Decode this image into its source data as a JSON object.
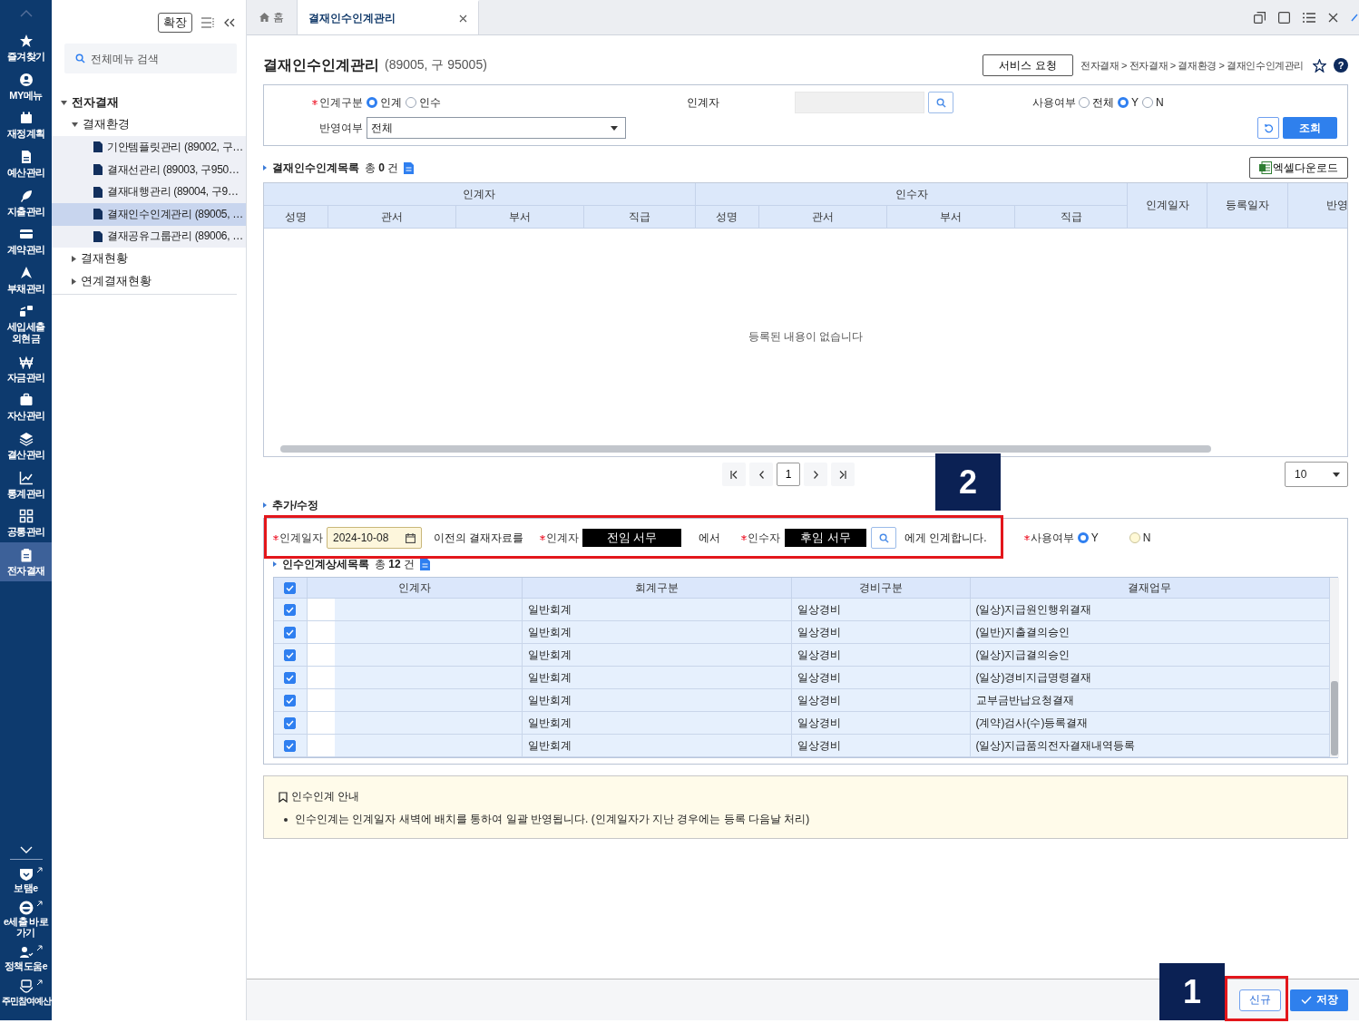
{
  "rail": {
    "items": [
      {
        "label": "즐겨찾기",
        "selected": false
      },
      {
        "label": "MY메뉴",
        "selected": false
      },
      {
        "label": "재정계획",
        "selected": false
      },
      {
        "label": "예산관리",
        "selected": false
      },
      {
        "label": "지출관리",
        "selected": false
      },
      {
        "label": "계약관리",
        "selected": false
      },
      {
        "label": "부채관리",
        "selected": false
      },
      {
        "label": "세입세출 외현금",
        "selected": false
      },
      {
        "label": "자금관리",
        "selected": false
      },
      {
        "label": "자산관리",
        "selected": false
      },
      {
        "label": "결산관리",
        "selected": false
      },
      {
        "label": "통계관리",
        "selected": false
      },
      {
        "label": "공통관리",
        "selected": false
      },
      {
        "label": "전자결재",
        "selected": true
      }
    ],
    "links": [
      {
        "label": "보탬e"
      },
      {
        "label": "e세출 바로가기"
      },
      {
        "label": "정책도움e"
      },
      {
        "label": "주민참여예산"
      }
    ]
  },
  "menu": {
    "expand_button": "확장",
    "search": {
      "placeholder": "전체메뉴 검색"
    },
    "tree": [
      {
        "label": "전자결재",
        "expanded": true,
        "children": [
          {
            "label": "결재환경",
            "expanded": true,
            "children": [
              {
                "label": "기안템플릿관리 (89002, 구…",
                "selected": false
              },
              {
                "label": "결재선관리 (89003, 구950…",
                "selected": false
              },
              {
                "label": "결재대행관리 (89004, 구9…",
                "selected": false
              },
              {
                "label": "결재인수인계관리 (89005, …",
                "selected": true
              },
              {
                "label": "결재공유그룹관리 (89006, …",
                "selected": false
              }
            ]
          },
          {
            "label": "결재현황",
            "expanded": false
          },
          {
            "label": "연계결재현황",
            "expanded": false
          }
        ]
      }
    ]
  },
  "tabs": [
    {
      "kind": "home",
      "label": "홈",
      "selected": false
    },
    {
      "kind": "page",
      "label": "결재인수인계관리",
      "selected": true
    }
  ],
  "page": {
    "title": "결재인수인계관리",
    "code": "(89005, 구 95005)",
    "service_button": "서비스 요청",
    "breadcrumb": "전자결재 > 전자결재 > 결재환경 > 결재인수인계관리",
    "help_button": "?"
  },
  "search_form": {
    "transfer_type": {
      "label": "인계구분",
      "required": true,
      "options": [
        {
          "label": "인계",
          "selected": true
        },
        {
          "label": "인수",
          "selected": false
        }
      ]
    },
    "giver": {
      "label": "인계자"
    },
    "use": {
      "label": "사용여부",
      "options": [
        {
          "label": "전체",
          "selected": false
        },
        {
          "label": "Y",
          "selected": true
        },
        {
          "label": "N",
          "selected": false
        }
      ]
    },
    "reflect": {
      "label": "반영여부",
      "value": "전체"
    },
    "search_button": "조회"
  },
  "list": {
    "title": "결재인수인계목록",
    "count": "총 **0** 건",
    "excel_button": "엑셀다운로드",
    "table": {
      "groups": [
        {
          "label": "인계자",
          "columns": [
            "성명",
            "관서",
            "부서",
            "직급"
          ]
        },
        {
          "label": "인수자",
          "columns": [
            "성명",
            "관서",
            "부서",
            "직급"
          ]
        }
      ],
      "columns": [
        "인계일자",
        "등록일자",
        "반영"
      ],
      "empty_message": "등록된 내용이 없습니다"
    },
    "pager": {
      "pages": [
        {
          "label": "1",
          "selected": true
        }
      ],
      "page_size": "10"
    }
  },
  "edit": {
    "title": "추가/수정",
    "form": {
      "date": {
        "label": "인계일자",
        "required": true,
        "value": "2024-10-08"
      },
      "text1": "이전의 결재자료를",
      "giver": {
        "label": "인계자",
        "required": true,
        "value": "전임 서무"
      },
      "text2": "에서",
      "receiver": {
        "label": "인수자",
        "required": true,
        "value": "후임 서무"
      },
      "text3": "에게 인계합니다.",
      "use": {
        "label": "사용여부",
        "required": true,
        "options": [
          {
            "label": "Y",
            "selected": true
          },
          {
            "label": "N",
            "selected": false
          }
        ]
      }
    },
    "detail": {
      "title": "인수인계상세목록",
      "count": "총 **12** 건",
      "all_checked": true,
      "columns": [
        "인계자",
        "회계구분",
        "경비구분",
        "결재업무"
      ],
      "rows": [
        {
          "checked": true,
          "cells": [
            "",
            "일반회계",
            "일상경비",
            "(일상)지급원인행위결재"
          ]
        },
        {
          "checked": true,
          "cells": [
            "",
            "일반회계",
            "일상경비",
            "(일반)지출결의승인"
          ]
        },
        {
          "checked": true,
          "cells": [
            "",
            "일반회계",
            "일상경비",
            "(일상)지급결의승인"
          ]
        },
        {
          "checked": true,
          "cells": [
            "",
            "일반회계",
            "일상경비",
            "(일상)경비지급명령결재"
          ]
        },
        {
          "checked": true,
          "cells": [
            "",
            "일반회계",
            "일상경비",
            "교부금반납요청결재"
          ]
        },
        {
          "checked": true,
          "cells": [
            "",
            "일반회계",
            "일상경비",
            "(계약)검사(수)등록결재"
          ]
        },
        {
          "checked": true,
          "cells": [
            "",
            "일반회계",
            "일상경비",
            "(일상)지급품의전자결재내역등록"
          ]
        }
      ]
    }
  },
  "notice": {
    "title": "인수인계 안내",
    "items": [
      "인수인계는 인계일자 새벽에 배치를 통하여 일괄 반영됩니다. (인계일자가 지난 경우에는 등록 다음날 처리)"
    ]
  },
  "footer": {
    "buttons": [
      {
        "kind": "secondary",
        "label": "신규"
      },
      {
        "kind": "primary",
        "label": "저장"
      }
    ]
  },
  "annotations": [
    {
      "label": "2"
    },
    {
      "label": "1"
    }
  ]
}
